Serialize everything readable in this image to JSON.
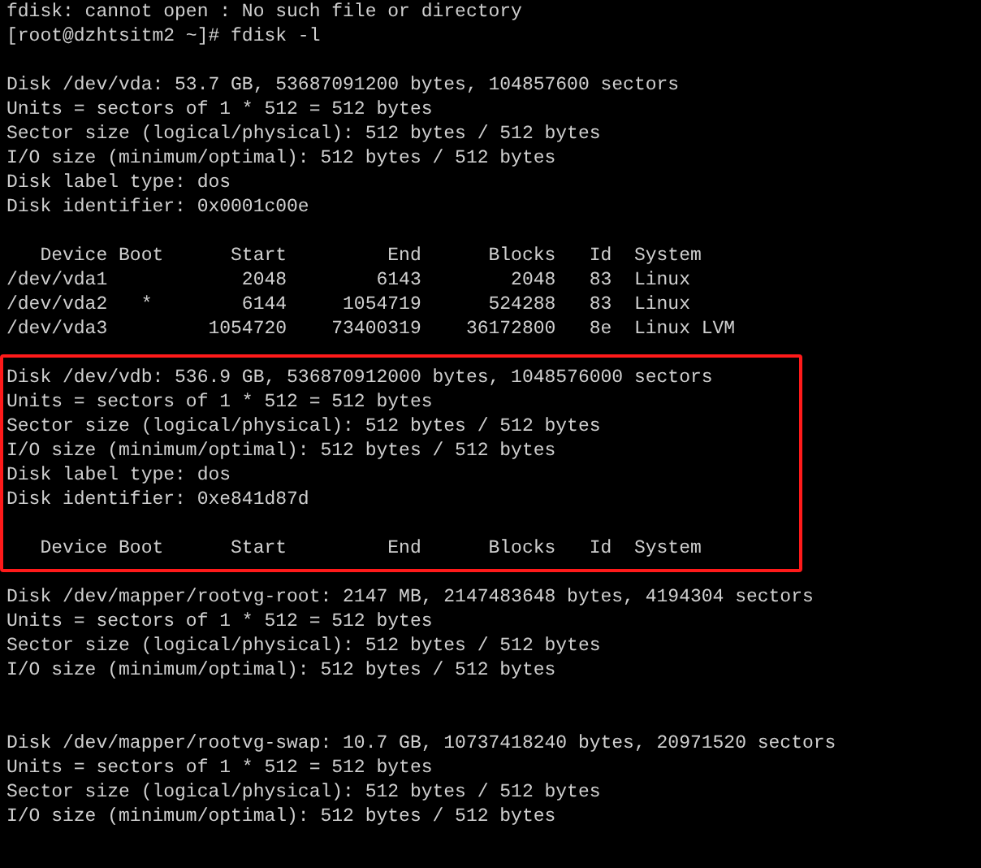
{
  "terminal": {
    "blocks": [
      {
        "highlighted": false,
        "lines": [
          {
            "text": "fdisk: cannot open : No such file or directory"
          },
          {
            "text": "[root@dzhtsitm2 ~]# fdisk -l"
          },
          {
            "kind": "blank"
          },
          {
            "text": "Disk /dev/vda: 53.7 GB, 53687091200 bytes, 104857600 sectors"
          },
          {
            "text": "Units = sectors of 1 * 512 = 512 bytes"
          },
          {
            "text": "Sector size (logical/physical): 512 bytes / 512 bytes"
          },
          {
            "text": "I/O size (minimum/optimal): 512 bytes / 512 bytes"
          },
          {
            "text": "Disk label type: dos"
          },
          {
            "text": "Disk identifier: 0x0001c00e"
          },
          {
            "kind": "blank"
          },
          {
            "text": "   Device Boot      Start         End      Blocks   Id  System"
          },
          {
            "text": "/dev/vda1            2048        6143        2048   83  Linux"
          },
          {
            "text": "/dev/vda2   *        6144     1054719      524288   83  Linux"
          },
          {
            "text": "/dev/vda3         1054720    73400319    36172800   8e  Linux LVM"
          }
        ]
      },
      {
        "highlighted": true,
        "lines": [
          {
            "text": "Disk /dev/vdb: 536.9 GB, 536870912000 bytes, 1048576000 sectors"
          },
          {
            "text": "Units = sectors of 1 * 512 = 512 bytes"
          },
          {
            "text": "Sector size (logical/physical): 512 bytes / 512 bytes"
          },
          {
            "text": "I/O size (minimum/optimal): 512 bytes / 512 bytes"
          },
          {
            "text": "Disk label type: dos"
          },
          {
            "text": "Disk identifier: 0xe841d87d"
          },
          {
            "kind": "blank"
          },
          {
            "text": "   Device Boot      Start         End      Blocks   Id  System"
          }
        ]
      },
      {
        "highlighted": false,
        "lines": [
          {
            "text": "Disk /dev/mapper/rootvg-root: 2147 MB, 2147483648 bytes, 4194304 sectors"
          },
          {
            "text": "Units = sectors of 1 * 512 = 512 bytes"
          },
          {
            "text": "Sector size (logical/physical): 512 bytes / 512 bytes"
          },
          {
            "text": "I/O size (minimum/optimal): 512 bytes / 512 bytes"
          },
          {
            "kind": "blank"
          },
          {
            "kind": "blank"
          },
          {
            "text": "Disk /dev/mapper/rootvg-swap: 10.7 GB, 10737418240 bytes, 20971520 sectors"
          },
          {
            "text": "Units = sectors of 1 * 512 = 512 bytes"
          },
          {
            "text": "Sector size (logical/physical): 512 bytes / 512 bytes"
          },
          {
            "text": "I/O size (minimum/optimal): 512 bytes / 512 bytes"
          }
        ]
      }
    ]
  }
}
